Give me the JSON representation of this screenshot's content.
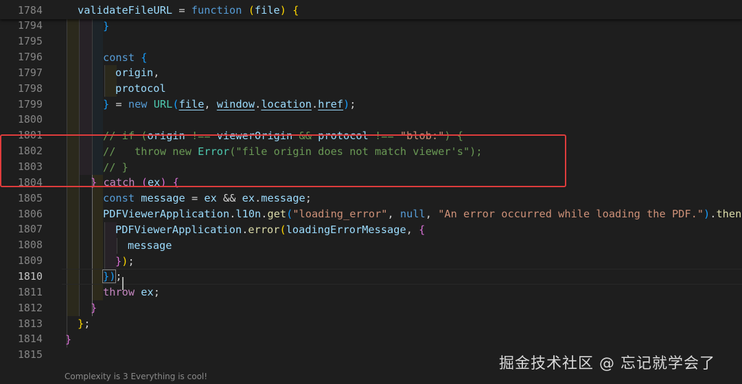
{
  "sticky": {
    "number": "1784",
    "tokens": [
      {
        "t": "validateFileURL",
        "c": "v"
      },
      {
        "t": " = ",
        "c": "p"
      },
      {
        "t": "function",
        "c": "k"
      },
      {
        "t": " ",
        "c": "p"
      },
      {
        "t": "(",
        "c": "b1"
      },
      {
        "t": "file",
        "c": "v"
      },
      {
        "t": ")",
        "c": "b1"
      },
      {
        "t": " ",
        "c": "p"
      },
      {
        "t": "{",
        "c": "b1"
      }
    ]
  },
  "lines": [
    {
      "number": "1794",
      "tokens": [
        {
          "t": "}",
          "c": "b3"
        }
      ]
    },
    {
      "number": "1795",
      "tokens": []
    },
    {
      "number": "1796",
      "tokens": [
        {
          "t": "const",
          "c": "k"
        },
        {
          "t": " ",
          "c": "p"
        },
        {
          "t": "{",
          "c": "b3"
        }
      ]
    },
    {
      "number": "1797",
      "tokens": [
        {
          "t": "origin",
          "c": "v"
        },
        {
          "t": ",",
          "c": "p"
        }
      ]
    },
    {
      "number": "1798",
      "tokens": [
        {
          "t": "protocol",
          "c": "v"
        }
      ]
    },
    {
      "number": "1799",
      "tokens": [
        {
          "t": "}",
          "c": "b3"
        },
        {
          "t": " = ",
          "c": "p"
        },
        {
          "t": "new",
          "c": "k"
        },
        {
          "t": " ",
          "c": "p"
        },
        {
          "t": "URL",
          "c": "t"
        },
        {
          "t": "(",
          "c": "b3"
        },
        {
          "t": "file",
          "c": "v ul"
        },
        {
          "t": ", ",
          "c": "p"
        },
        {
          "t": "window",
          "c": "v ul"
        },
        {
          "t": ".",
          "c": "p"
        },
        {
          "t": "location",
          "c": "v ul"
        },
        {
          "t": ".",
          "c": "p"
        },
        {
          "t": "href",
          "c": "v ul"
        },
        {
          "t": ")",
          "c": "b3"
        },
        {
          "t": ";",
          "c": "p"
        }
      ]
    },
    {
      "number": "1800",
      "tokens": []
    },
    {
      "number": "1801",
      "tokens": [
        {
          "t": "// if (",
          "c": "c"
        },
        {
          "t": "origin",
          "c": "v"
        },
        {
          "t": " !== ",
          "c": "c"
        },
        {
          "t": "viewerOrigin",
          "c": "v"
        },
        {
          "t": " && ",
          "c": "c"
        },
        {
          "t": "protocol",
          "c": "v"
        },
        {
          "t": " !== ",
          "c": "c"
        },
        {
          "t": "\"blob:\"",
          "c": "s"
        },
        {
          "t": ") {",
          "c": "c"
        }
      ]
    },
    {
      "number": "1802",
      "tokens": [
        {
          "t": "//   throw new ",
          "c": "c"
        },
        {
          "t": "Error",
          "c": "t"
        },
        {
          "t": "(\"file origin does not match viewer's\");",
          "c": "c"
        }
      ]
    },
    {
      "number": "1803",
      "tokens": [
        {
          "t": "// }",
          "c": "c"
        }
      ]
    },
    {
      "number": "1804",
      "tokens": [
        {
          "t": "}",
          "c": "b2"
        },
        {
          "t": " ",
          "c": "p"
        },
        {
          "t": "catch",
          "c": "kc"
        },
        {
          "t": " ",
          "c": "p"
        },
        {
          "t": "(",
          "c": "b2"
        },
        {
          "t": "ex",
          "c": "v"
        },
        {
          "t": ")",
          "c": "b2"
        },
        {
          "t": " ",
          "c": "p"
        },
        {
          "t": "{",
          "c": "b2"
        }
      ]
    },
    {
      "number": "1805",
      "tokens": [
        {
          "t": "const",
          "c": "k"
        },
        {
          "t": " ",
          "c": "p"
        },
        {
          "t": "message",
          "c": "v"
        },
        {
          "t": " = ",
          "c": "p"
        },
        {
          "t": "ex",
          "c": "v"
        },
        {
          "t": " && ",
          "c": "p"
        },
        {
          "t": "ex",
          "c": "v"
        },
        {
          "t": ".",
          "c": "p"
        },
        {
          "t": "message",
          "c": "v"
        },
        {
          "t": ";",
          "c": "p"
        }
      ]
    },
    {
      "number": "1806",
      "tokens": [
        {
          "t": "PDFViewerApplication",
          "c": "v"
        },
        {
          "t": ".",
          "c": "p"
        },
        {
          "t": "l10n",
          "c": "v"
        },
        {
          "t": ".",
          "c": "p"
        },
        {
          "t": "get",
          "c": "f"
        },
        {
          "t": "(",
          "c": "b3"
        },
        {
          "t": "\"loading_error\"",
          "c": "s"
        },
        {
          "t": ", ",
          "c": "p"
        },
        {
          "t": "null",
          "c": "k"
        },
        {
          "t": ", ",
          "c": "p"
        },
        {
          "t": "\"An error occurred while loading the PDF.\"",
          "c": "s"
        },
        {
          "t": ")",
          "c": "b3"
        },
        {
          "t": ".",
          "c": "p"
        },
        {
          "t": "then",
          "c": "f"
        }
      ]
    },
    {
      "number": "1807",
      "tokens": [
        {
          "t": "PDFViewerApplication",
          "c": "v"
        },
        {
          "t": ".",
          "c": "p"
        },
        {
          "t": "error",
          "c": "f"
        },
        {
          "t": "(",
          "c": "b1"
        },
        {
          "t": "loadingErrorMessage",
          "c": "v"
        },
        {
          "t": ", ",
          "c": "p"
        },
        {
          "t": "{",
          "c": "b2"
        }
      ]
    },
    {
      "number": "1808",
      "tokens": [
        {
          "t": "message",
          "c": "v"
        }
      ]
    },
    {
      "number": "1809",
      "tokens": [
        {
          "t": "}",
          "c": "b2"
        },
        {
          "t": ")",
          "c": "b1"
        },
        {
          "t": ";",
          "c": "p"
        }
      ]
    },
    {
      "number": "1810",
      "tokens": [
        {
          "t": "})",
          "c": "b3 bm"
        },
        {
          "t": ";",
          "c": "p"
        }
      ]
    },
    {
      "number": "1811",
      "tokens": [
        {
          "t": "throw",
          "c": "kc"
        },
        {
          "t": " ",
          "c": "p"
        },
        {
          "t": "ex",
          "c": "v"
        },
        {
          "t": ";",
          "c": "p"
        }
      ]
    },
    {
      "number": "1812",
      "tokens": [
        {
          "t": "}",
          "c": "b2"
        }
      ]
    },
    {
      "number": "1813",
      "tokens": [
        {
          "t": "}",
          "c": "b1"
        },
        {
          "t": ";",
          "c": "p"
        }
      ]
    },
    {
      "number": "1814",
      "tokens": [
        {
          "t": "}",
          "c": "b2"
        }
      ]
    },
    {
      "number": "1815",
      "tokens": []
    }
  ],
  "active_line": "1810",
  "status_text": "Complexity is 3 Everything is cool!",
  "watermark": "掘金技术社区 @ 忘记就学会了",
  "annotation": "red-rectangle-highlight"
}
